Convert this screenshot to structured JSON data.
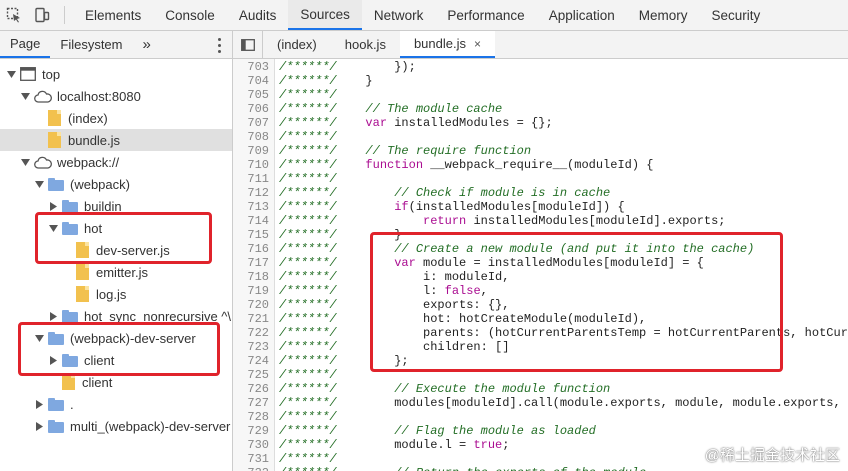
{
  "panel_tabs": [
    "Elements",
    "Console",
    "Audits",
    "Sources",
    "Network",
    "Performance",
    "Application",
    "Memory",
    "Security"
  ],
  "active_panel": "Sources",
  "navigator_tabs": {
    "page": "Page",
    "filesystem": "Filesystem",
    "more": "»"
  },
  "tree": [
    {
      "label": "top",
      "type": "frame",
      "expanded": true
    },
    {
      "label": "localhost:8080",
      "type": "cloud",
      "expanded": true
    },
    {
      "label": "(index)",
      "type": "file"
    },
    {
      "label": "bundle.js",
      "type": "file",
      "selected": true
    },
    {
      "label": "webpack://",
      "type": "cloud",
      "expanded": true
    },
    {
      "label": "(webpack)",
      "type": "folder",
      "expanded": true
    },
    {
      "label": "buildin",
      "type": "folder",
      "expanded": false
    },
    {
      "label": "hot",
      "type": "folder",
      "expanded": true
    },
    {
      "label": "dev-server.js",
      "type": "file"
    },
    {
      "label": "emitter.js",
      "type": "file"
    },
    {
      "label": "log.js",
      "type": "file"
    },
    {
      "label": "hot_sync_nonrecursive ^\\",
      "type": "folder",
      "expanded": false
    },
    {
      "label": "(webpack)-dev-server",
      "type": "folder",
      "expanded": true
    },
    {
      "label": "client",
      "type": "folder",
      "expanded": false
    },
    {
      "label": "client",
      "type": "file"
    },
    {
      "label": ".",
      "type": "folder",
      "expanded": false
    },
    {
      "label": "multi_(webpack)-dev-server",
      "type": "folder",
      "expanded": false
    }
  ],
  "file_tabs": [
    {
      "label": "(index)",
      "active": false
    },
    {
      "label": "hook.js",
      "active": false
    },
    {
      "label": "bundle.js",
      "active": true,
      "close": "×"
    }
  ],
  "code_lines": [
    {
      "n": "703",
      "prefix": "/******/",
      "code": "        });",
      "cls": "tx"
    },
    {
      "n": "704",
      "prefix": "/******/",
      "code": "    }",
      "cls": "tx"
    },
    {
      "n": "705",
      "prefix": "/******/",
      "code": "",
      "cls": "tx"
    },
    {
      "n": "706",
      "prefix": "/******/",
      "code": "    // The module cache",
      "cls": "cm"
    },
    {
      "n": "707",
      "prefix": "/******/",
      "code": "    var installedModules = {};",
      "cls": "tx"
    },
    {
      "n": "708",
      "prefix": "/******/",
      "code": "",
      "cls": "tx"
    },
    {
      "n": "709",
      "prefix": "/******/",
      "code": "    // The require function",
      "cls": "cm"
    },
    {
      "n": "710",
      "prefix": "/******/",
      "code": "    function __webpack_require__(moduleId) {",
      "cls": "tx"
    },
    {
      "n": "711",
      "prefix": "/******/",
      "code": "",
      "cls": "tx"
    },
    {
      "n": "712",
      "prefix": "/******/",
      "code": "        // Check if module is in cache",
      "cls": "cm"
    },
    {
      "n": "713",
      "prefix": "/******/",
      "code": "        if(installedModules[moduleId]) {",
      "cls": "tx"
    },
    {
      "n": "714",
      "prefix": "/******/",
      "code": "            return installedModules[moduleId].exports;",
      "cls": "tx"
    },
    {
      "n": "715",
      "prefix": "/******/",
      "code": "        }",
      "cls": "tx"
    },
    {
      "n": "716",
      "prefix": "/******/",
      "code": "        // Create a new module (and put it into the cache)",
      "cls": "cm"
    },
    {
      "n": "717",
      "prefix": "/******/",
      "code": "        var module = installedModules[moduleId] = {",
      "cls": "tx"
    },
    {
      "n": "718",
      "prefix": "/******/",
      "code": "            i: moduleId,",
      "cls": "tx"
    },
    {
      "n": "719",
      "prefix": "/******/",
      "code": "            l: false,",
      "cls": "tx"
    },
    {
      "n": "720",
      "prefix": "/******/",
      "code": "            exports: {},",
      "cls": "tx"
    },
    {
      "n": "721",
      "prefix": "/******/",
      "code": "            hot: hotCreateModule(moduleId),",
      "cls": "tx"
    },
    {
      "n": "722",
      "prefix": "/******/",
      "code": "            parents: (hotCurrentParentsTemp = hotCurrentParents, hotCur",
      "cls": "tx"
    },
    {
      "n": "723",
      "prefix": "/******/",
      "code": "            children: []",
      "cls": "tx"
    },
    {
      "n": "724",
      "prefix": "/******/",
      "code": "        };",
      "cls": "tx"
    },
    {
      "n": "725",
      "prefix": "/******/",
      "code": "",
      "cls": "tx"
    },
    {
      "n": "726",
      "prefix": "/******/",
      "code": "        // Execute the module function",
      "cls": "cm"
    },
    {
      "n": "727",
      "prefix": "/******/",
      "code": "        modules[moduleId].call(module.exports, module, module.exports,",
      "cls": "tx"
    },
    {
      "n": "728",
      "prefix": "/******/",
      "code": "",
      "cls": "tx"
    },
    {
      "n": "729",
      "prefix": "/******/",
      "code": "        // Flag the module as loaded",
      "cls": "cm"
    },
    {
      "n": "730",
      "prefix": "/******/",
      "code": "        module.l = true;",
      "cls": "tx"
    },
    {
      "n": "731",
      "prefix": "/******/",
      "code": "",
      "cls": "tx"
    },
    {
      "n": "732",
      "prefix": "/******/",
      "code": "        // Return the exports of the module",
      "cls": "cm"
    }
  ],
  "watermark": "@稀土掘金技术社区",
  "colors": {
    "accent": "#1a73e8",
    "highlight_box": "#e0232b",
    "folder": "#7fa8e0",
    "file": "#f2c14e",
    "comment": "#236e25",
    "keyword": "#aa0d91"
  }
}
